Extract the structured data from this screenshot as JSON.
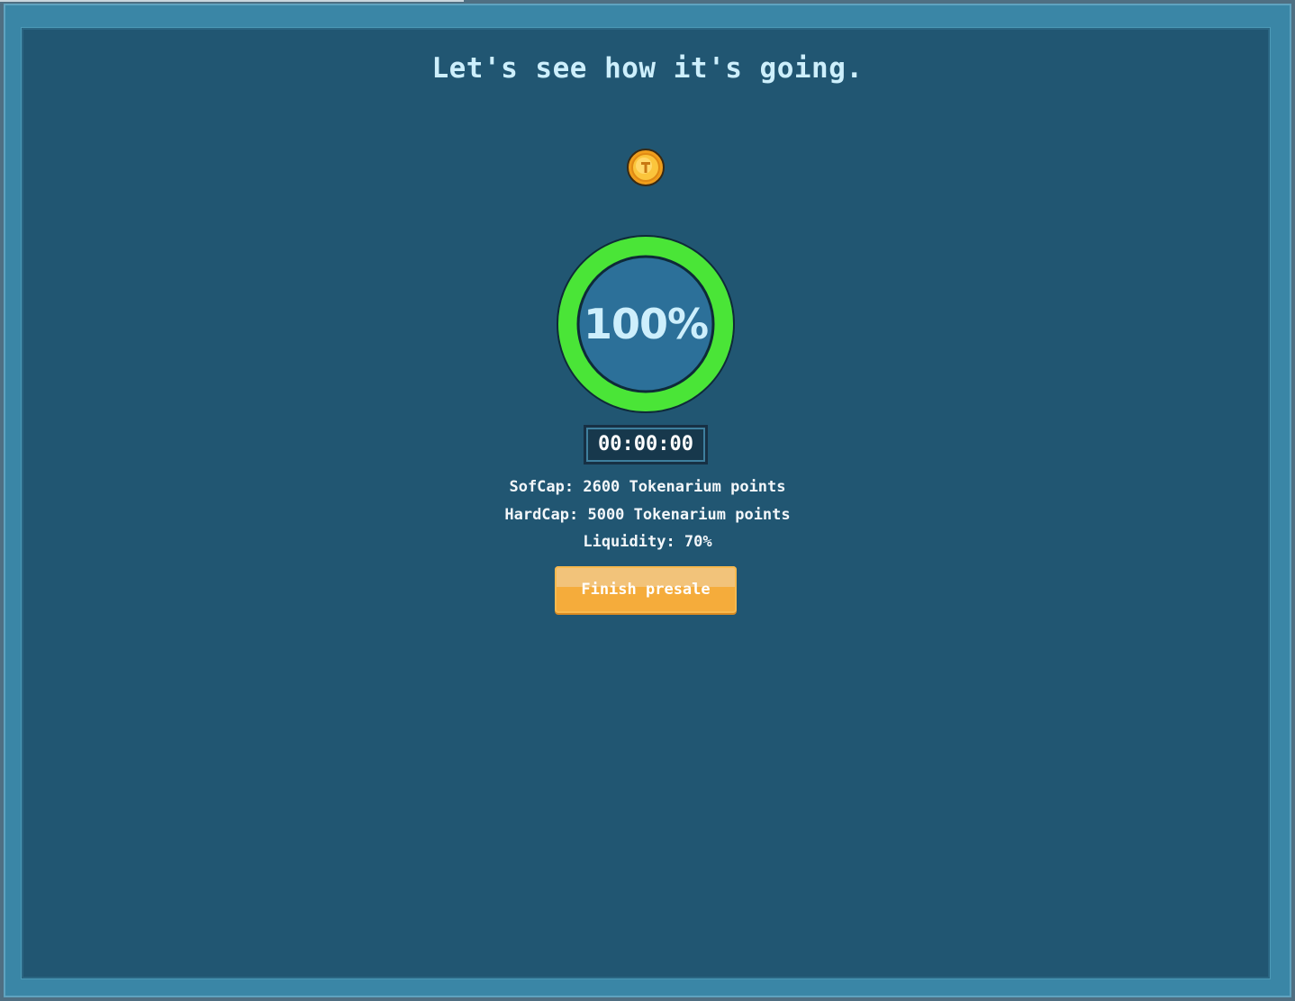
{
  "header": {
    "title": "Let's see how it's going."
  },
  "token": {
    "icon": "coin-icon",
    "icon_color": "#f7b52c"
  },
  "progress": {
    "percent_label": "100%",
    "value": 1.0,
    "ring_color": "#4ae537",
    "inner_color": "#2c7099"
  },
  "timer": {
    "value": "00:00:00"
  },
  "info": {
    "softcap": "SofCap: 2600 Tokenarium points",
    "hardcap": "HardCap: 5000 Tokenarium points",
    "liquidity": "Liquidity: 70%"
  },
  "actions": {
    "finish_label": "Finish presale",
    "finish_color": "#f5ac3b"
  }
}
